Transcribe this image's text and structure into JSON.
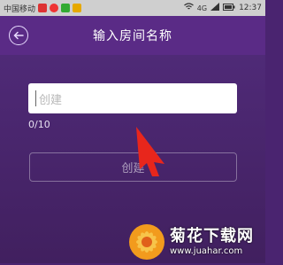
{
  "statusbar": {
    "carrier": "中国移动",
    "data_badge": "4G",
    "network": "4G",
    "time": "12:37"
  },
  "header": {
    "title": "输入房间名称",
    "back_icon": "back-arrow-icon"
  },
  "form": {
    "room_name": {
      "value": "",
      "placeholder": "创建"
    },
    "counter": "0/10",
    "submit_label": "创建"
  },
  "watermark": {
    "title": "菊花下载网",
    "url": "www.juahar.com"
  },
  "colors": {
    "header_bg": "#5a2b86",
    "content_bg": "#4a2470",
    "annotation_arrow": "#e8261c"
  }
}
